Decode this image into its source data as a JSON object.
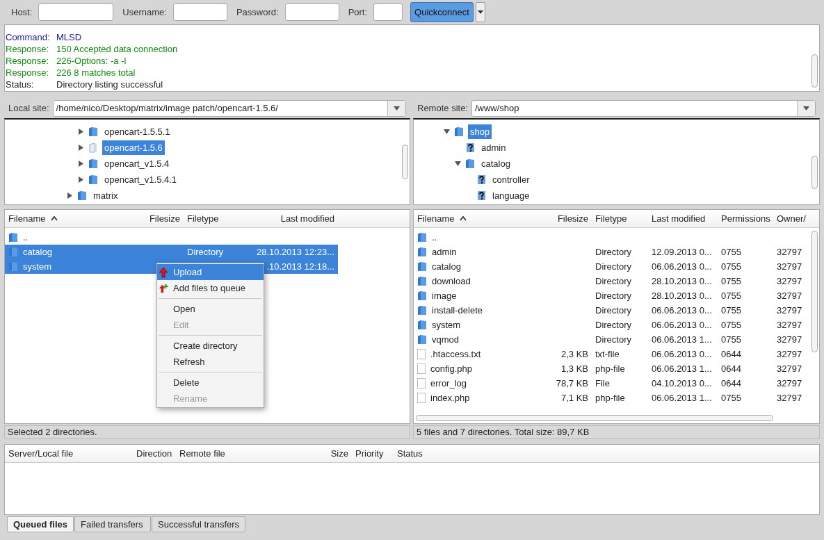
{
  "quickconnect": {
    "fields": [
      {
        "label": "Host:"
      },
      {
        "label": "Username:"
      },
      {
        "label": "Password:"
      },
      {
        "label": "Port:"
      }
    ],
    "button": "Quickconnect"
  },
  "log": [
    {
      "kind": "command",
      "tag": "Command:",
      "text": "MLSD"
    },
    {
      "kind": "response",
      "tag": "Response:",
      "text": "150 Accepted data connection"
    },
    {
      "kind": "response",
      "tag": "Response:",
      "text": "226-Options: -a -l"
    },
    {
      "kind": "response",
      "tag": "Response:",
      "text": "226 8 matches total"
    },
    {
      "kind": "status",
      "tag": "Status:",
      "text": "Directory listing successful"
    }
  ],
  "local": {
    "site_label": "Local site:",
    "path": "/home/nico/Desktop/matrix/image patch/opencart-1.5.6/",
    "tree": {
      "items": [
        {
          "label": "opencart-1.5.5.1",
          "kind": "folder",
          "expanded": false,
          "selected": false
        },
        {
          "label": "opencart-1.5.6",
          "kind": "open-folder",
          "expanded": false,
          "selected": true
        },
        {
          "label": "opencart_v1.5.4",
          "kind": "folder",
          "expanded": false,
          "selected": false
        },
        {
          "label": "opencart_v1.5.4.1",
          "kind": "folder",
          "expanded": false,
          "selected": false
        }
      ],
      "outer_items": [
        {
          "label": "matrix",
          "kind": "folder",
          "expanded": false,
          "selected": false
        }
      ]
    },
    "columns": [
      "Filename",
      "Filesize",
      "Filetype",
      "Last modified"
    ],
    "rows": [
      {
        "kind": "folder",
        "cells": [
          ".."
        ],
        "selected": false
      },
      {
        "kind": "folder",
        "cells": [
          "catalog",
          "",
          "Directory",
          "28.10.2013 12:23..."
        ],
        "selected": true
      },
      {
        "kind": "folder",
        "cells": [
          "system",
          "",
          "",
          ".10.2013 12:18..."
        ],
        "selected": true
      }
    ],
    "status": "Selected 2 directories."
  },
  "remote": {
    "site_label": "Remote site:",
    "path": "/www/shop",
    "tree": {
      "items": [
        {
          "label": "shop",
          "kind": "folder",
          "expanded": true,
          "selected": true,
          "children": [
            {
              "label": "admin",
              "kind": "unknown",
              "selected": false
            },
            {
              "label": "catalog",
              "kind": "folder",
              "expanded": true,
              "selected": false,
              "children": [
                {
                  "label": "controller",
                  "kind": "unknown",
                  "selected": false
                },
                {
                  "label": "language",
                  "kind": "unknown",
                  "selected": false
                }
              ]
            }
          ]
        }
      ]
    },
    "columns": [
      "Filename",
      "Filesize",
      "Filetype",
      "Last modified",
      "Permissions",
      "Owner/"
    ],
    "rows": [
      {
        "kind": "folder",
        "cells": [
          ".."
        ],
        "selected": false
      },
      {
        "kind": "folder",
        "cells": [
          "admin",
          "",
          "Directory",
          "12.09.2013 0...",
          "0755",
          "32797"
        ],
        "selected": false
      },
      {
        "kind": "folder",
        "cells": [
          "catalog",
          "",
          "Directory",
          "06.06.2013 0...",
          "0755",
          "32797"
        ],
        "selected": false
      },
      {
        "kind": "folder",
        "cells": [
          "download",
          "",
          "Directory",
          "28.10.2013 0...",
          "0755",
          "32797"
        ],
        "selected": false
      },
      {
        "kind": "folder",
        "cells": [
          "image",
          "",
          "Directory",
          "28.10.2013 0...",
          "0755",
          "32797"
        ],
        "selected": false
      },
      {
        "kind": "folder",
        "cells": [
          "install-delete",
          "",
          "Directory",
          "06.06.2013 0...",
          "0755",
          "32797"
        ],
        "selected": false
      },
      {
        "kind": "folder",
        "cells": [
          "system",
          "",
          "Directory",
          "06.06.2013 0...",
          "0755",
          "32797"
        ],
        "selected": false
      },
      {
        "kind": "folder",
        "cells": [
          "vqmod",
          "",
          "Directory",
          "06.06.2013 1...",
          "0755",
          "32797"
        ],
        "selected": false
      },
      {
        "kind": "file",
        "cells": [
          ".htaccess.txt",
          "2,3 KB",
          "txt-file",
          "06.06.2013 0...",
          "0644",
          "32797"
        ],
        "selected": false
      },
      {
        "kind": "file",
        "cells": [
          "config.php",
          "1,3 KB",
          "php-file",
          "06.06.2013 1...",
          "0644",
          "32797"
        ],
        "selected": false
      },
      {
        "kind": "file",
        "cells": [
          "error_log",
          "78,7 KB",
          "File",
          "04.10.2013 0...",
          "0644",
          "32797"
        ],
        "selected": false
      },
      {
        "kind": "file",
        "cells": [
          "index.php",
          "7,1 KB",
          "php-file",
          "06.06.2013 1...",
          "0755",
          "32797"
        ],
        "selected": false
      }
    ],
    "status": "5 files and 7 directories. Total size: 89,7 KB"
  },
  "context_menu": [
    {
      "kind": "upload",
      "label": "Upload",
      "disabled": false,
      "selected": true
    },
    {
      "kind": "add",
      "label": "Add files to queue",
      "disabled": false,
      "selected": false
    },
    {
      "kind": "separator"
    },
    {
      "kind": "item",
      "label": "Open",
      "disabled": false,
      "selected": false
    },
    {
      "kind": "item",
      "label": "Edit",
      "disabled": true,
      "selected": false
    },
    {
      "kind": "separator"
    },
    {
      "kind": "item",
      "label": "Create directory",
      "disabled": false,
      "selected": false
    },
    {
      "kind": "item",
      "label": "Refresh",
      "disabled": false,
      "selected": false
    },
    {
      "kind": "separator"
    },
    {
      "kind": "item",
      "label": "Delete",
      "disabled": false,
      "selected": false
    },
    {
      "kind": "item",
      "label": "Rename",
      "disabled": true,
      "selected": false
    }
  ],
  "queue": {
    "columns": [
      "Server/Local file",
      "Direction",
      "Remote file",
      "Size",
      "Priority",
      "Status"
    ]
  },
  "tabs": [
    {
      "label": "Queued files",
      "selected": true
    },
    {
      "label": "Failed transfers",
      "selected": false
    },
    {
      "label": "Successful transfers",
      "selected": false
    }
  ]
}
